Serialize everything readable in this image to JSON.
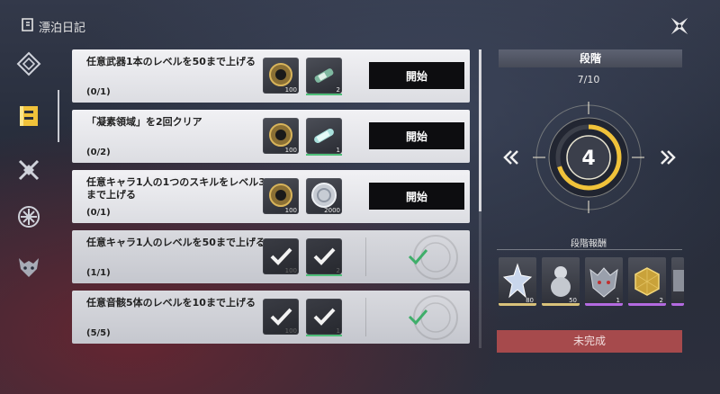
{
  "header": {
    "title": "漂泊日記"
  },
  "nav": {
    "items": [
      {
        "name": "compass"
      },
      {
        "name": "diary"
      },
      {
        "name": "crossed-blades"
      },
      {
        "name": "snowflake"
      },
      {
        "name": "demon-mask"
      }
    ],
    "active_index": 1
  },
  "tasks": [
    {
      "text": "任意武器1本のレベルを50まで上げる",
      "progress": "(0/1)",
      "rewards": [
        {
          "icon": "gear-coin-icon",
          "count": "100"
        },
        {
          "icon": "tuning-capsule-icon",
          "count": "2"
        }
      ],
      "button": "開始",
      "completed": false
    },
    {
      "text": "「凝素領域」を2回クリア",
      "progress": "(0/2)",
      "rewards": [
        {
          "icon": "gear-coin-icon",
          "count": "100"
        },
        {
          "icon": "crystal-vial-icon",
          "count": "1"
        }
      ],
      "button": "開始",
      "completed": false
    },
    {
      "text": "任意キャラ1人の1つのスキルをレベル3まで上げる",
      "progress": "(0/1)",
      "rewards": [
        {
          "icon": "gear-coin-icon",
          "count": "100"
        },
        {
          "icon": "shell-credit-icon",
          "count": "2000"
        }
      ],
      "button": "開始",
      "completed": false
    },
    {
      "text": "任意キャラ1人のレベルを50まで上げる",
      "progress": "(1/1)",
      "rewards": [
        {
          "icon": "check-icon",
          "count": "100"
        },
        {
          "icon": "check-icon",
          "count": "2"
        }
      ],
      "button": "",
      "completed": true
    },
    {
      "text": "任意音骸5体のレベルを10まで上げる",
      "progress": "(5/5)",
      "rewards": [
        {
          "icon": "check-icon",
          "count": "100"
        },
        {
          "icon": "check-icon",
          "count": "1"
        }
      ],
      "button": "",
      "completed": true
    }
  ],
  "stage_panel": {
    "header": "段階",
    "progress": "7/10",
    "progress_fraction": 0.7,
    "current_stage": "4",
    "rewards_title": "段階報酬",
    "rewards": [
      {
        "icon": "star-crystal-icon",
        "count": "80",
        "rarity_color": "#d9c27a"
      },
      {
        "icon": "gourd-icon",
        "count": "50",
        "rarity_color": "#d9c27a"
      },
      {
        "icon": "dragon-echo-icon",
        "count": "1",
        "rarity_color": "#b36ae0"
      },
      {
        "icon": "gold-cube-icon",
        "count": "2",
        "rarity_color": "#b36ae0"
      },
      {
        "icon": "item-icon",
        "count": "",
        "rarity_color": "#b36ae0"
      }
    ],
    "status_button": "未完成"
  },
  "colors": {
    "accent_gold": "#f0c23a",
    "incomplete_red": "#a64a4c",
    "check_green": "#3fae6a"
  }
}
